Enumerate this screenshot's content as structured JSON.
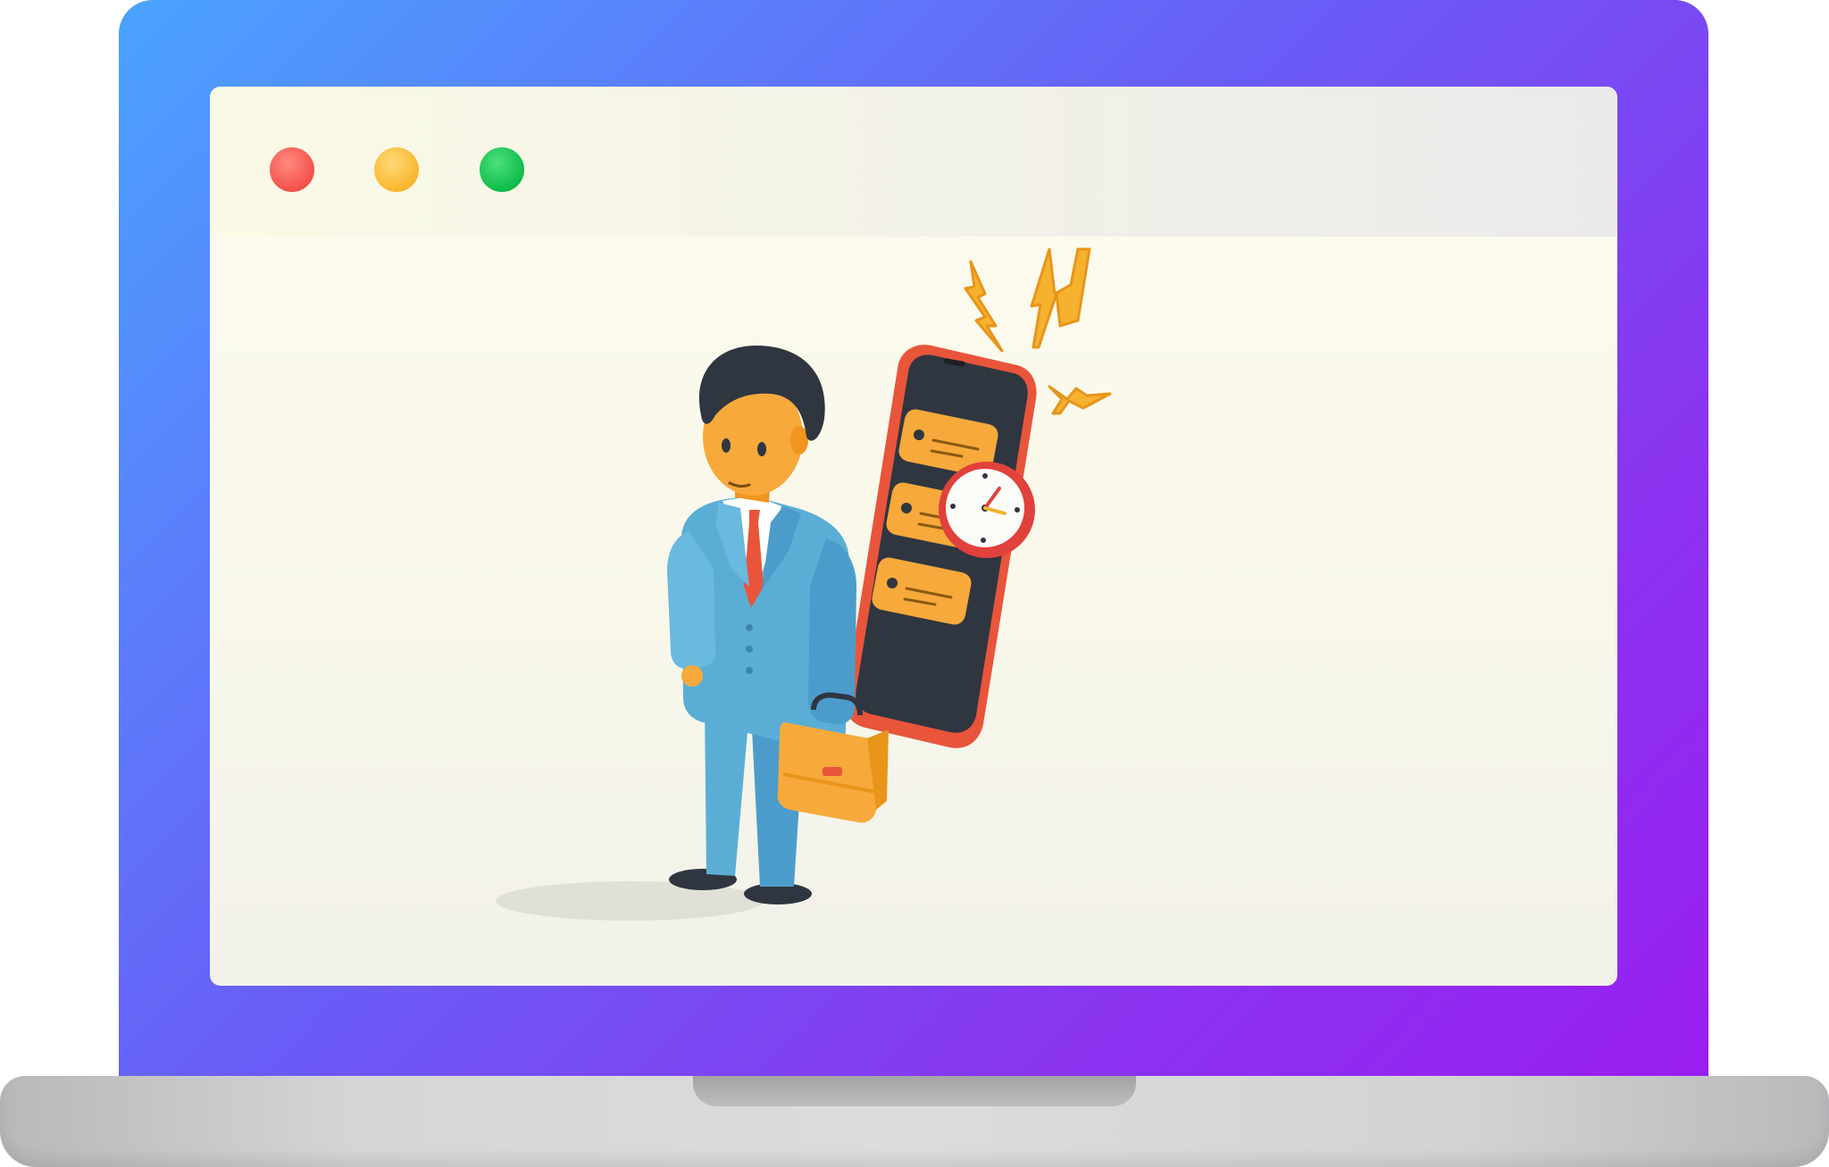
{
  "window": {
    "controls": [
      {
        "name": "close",
        "color": "#f4514a"
      },
      {
        "name": "minimize",
        "color": "#f8b72d"
      },
      {
        "name": "maximize",
        "color": "#0fbc49"
      }
    ]
  },
  "illustration": {
    "subject": "businessman-with-briefcase-icon",
    "elements": [
      "smartphone-icon",
      "notification-card-icon",
      "clock-icon",
      "lightning-icon",
      "briefcase-icon"
    ]
  },
  "colors": {
    "bezel_start": "#4aa3ff",
    "bezel_end": "#9a1ef0",
    "screen_bg": "#fdfcee",
    "accent_orange": "#f7a93b",
    "phone_frame": "#e8553b",
    "suit_blue": "#5aaed6"
  }
}
